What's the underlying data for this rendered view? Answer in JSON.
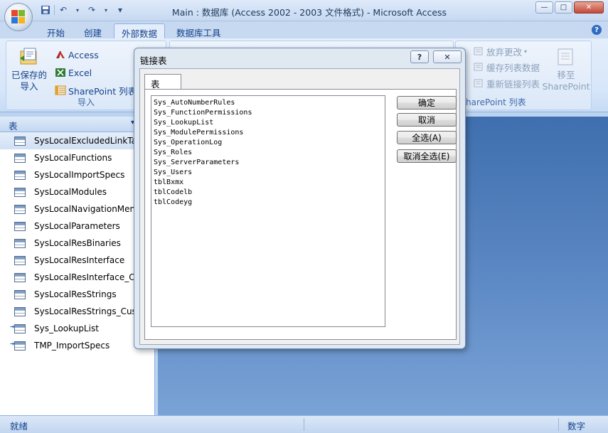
{
  "window": {
    "title": "Main : 数据库 (Access 2002 - 2003 文件格式) - Microsoft Access",
    "minimize_glyph": "—",
    "maximize_glyph": "□",
    "close_glyph": "✕"
  },
  "qat": {
    "save_icon": "save-icon",
    "undo_glyph": "↶",
    "redo_glyph": "↷",
    "customize_glyph": "▾"
  },
  "ribbon": {
    "tabs": [
      {
        "label": "开始"
      },
      {
        "label": "创建"
      },
      {
        "label": "外部数据",
        "active": true
      },
      {
        "label": "数据库工具"
      }
    ],
    "help_glyph": "?",
    "import_group": {
      "label": "导入",
      "saved_imports_line1": "已保存的",
      "saved_imports_line2": "导入",
      "access_label": "Access",
      "excel_label": "Excel",
      "sharepoint_label": "SharePoint 列表"
    },
    "sharepoint_group": {
      "label": "SharePoint 列表",
      "label_visible": "harePoint 列表",
      "discard_changes_label": "放弃更改",
      "cache_list_data_label": "缓存列表数据",
      "relink_lists_label": "重新链接列表",
      "move_to_line1": "移至",
      "move_to_line2": "SharePoint"
    }
  },
  "nav": {
    "header_label": "表",
    "header_chevron": "▾",
    "items": [
      {
        "label": "SysLocalExcludedLinkTables",
        "visible": "SysLocalExcludedLinkTa",
        "selected": true,
        "linked": false
      },
      {
        "label": "SysLocalFunctions",
        "visible": "SysLocalFunctions",
        "linked": false
      },
      {
        "label": "SysLocalImportSpecs",
        "visible": "SysLocalImportSpecs",
        "linked": false
      },
      {
        "label": "SysLocalModules",
        "visible": "SysLocalModules",
        "linked": false
      },
      {
        "label": "SysLocalNavigationMenu",
        "visible": "SysLocalNavigationMen",
        "linked": false
      },
      {
        "label": "SysLocalParameters",
        "visible": "SysLocalParameters",
        "linked": false
      },
      {
        "label": "SysLocalResBinaries",
        "visible": "SysLocalResBinaries",
        "linked": false
      },
      {
        "label": "SysLocalResInterface",
        "visible": "SysLocalResInterface",
        "linked": false
      },
      {
        "label": "SysLocalResInterface_Cu",
        "visible": "SysLocalResInterface_Cu",
        "linked": false
      },
      {
        "label": "SysLocalResStrings",
        "visible": "SysLocalResStrings",
        "linked": false
      },
      {
        "label": "SysLocalResStrings_Cust",
        "visible": "SysLocalResStrings_Cust",
        "linked": false
      },
      {
        "label": "Sys_LookupList",
        "visible": "Sys_LookupList",
        "linked": true
      },
      {
        "label": "TMP_ImportSpecs",
        "visible": "TMP_ImportSpecs",
        "linked": true
      }
    ]
  },
  "dialog": {
    "title": "链接表",
    "help_glyph": "?",
    "close_glyph": "✕",
    "tab_label": "表",
    "tables": [
      "Sys_AutoNumberRules",
      "Sys_FunctionPermissions",
      "Sys_LookupList",
      "Sys_ModulePermissions",
      "Sys_OperationLog",
      "Sys_Roles",
      "Sys_ServerParameters",
      "Sys_Users",
      "tblBxmx",
      "tblCodelb",
      "tblCodeyg"
    ],
    "ok_label": "确定",
    "cancel_label": "取消",
    "select_all_label": "全选(A)",
    "deselect_all_label": "取消全选(E)"
  },
  "status": {
    "left": "就绪",
    "right": "数字"
  },
  "colors": {
    "accent": "#15428b",
    "workspace": "#5d89c5"
  }
}
